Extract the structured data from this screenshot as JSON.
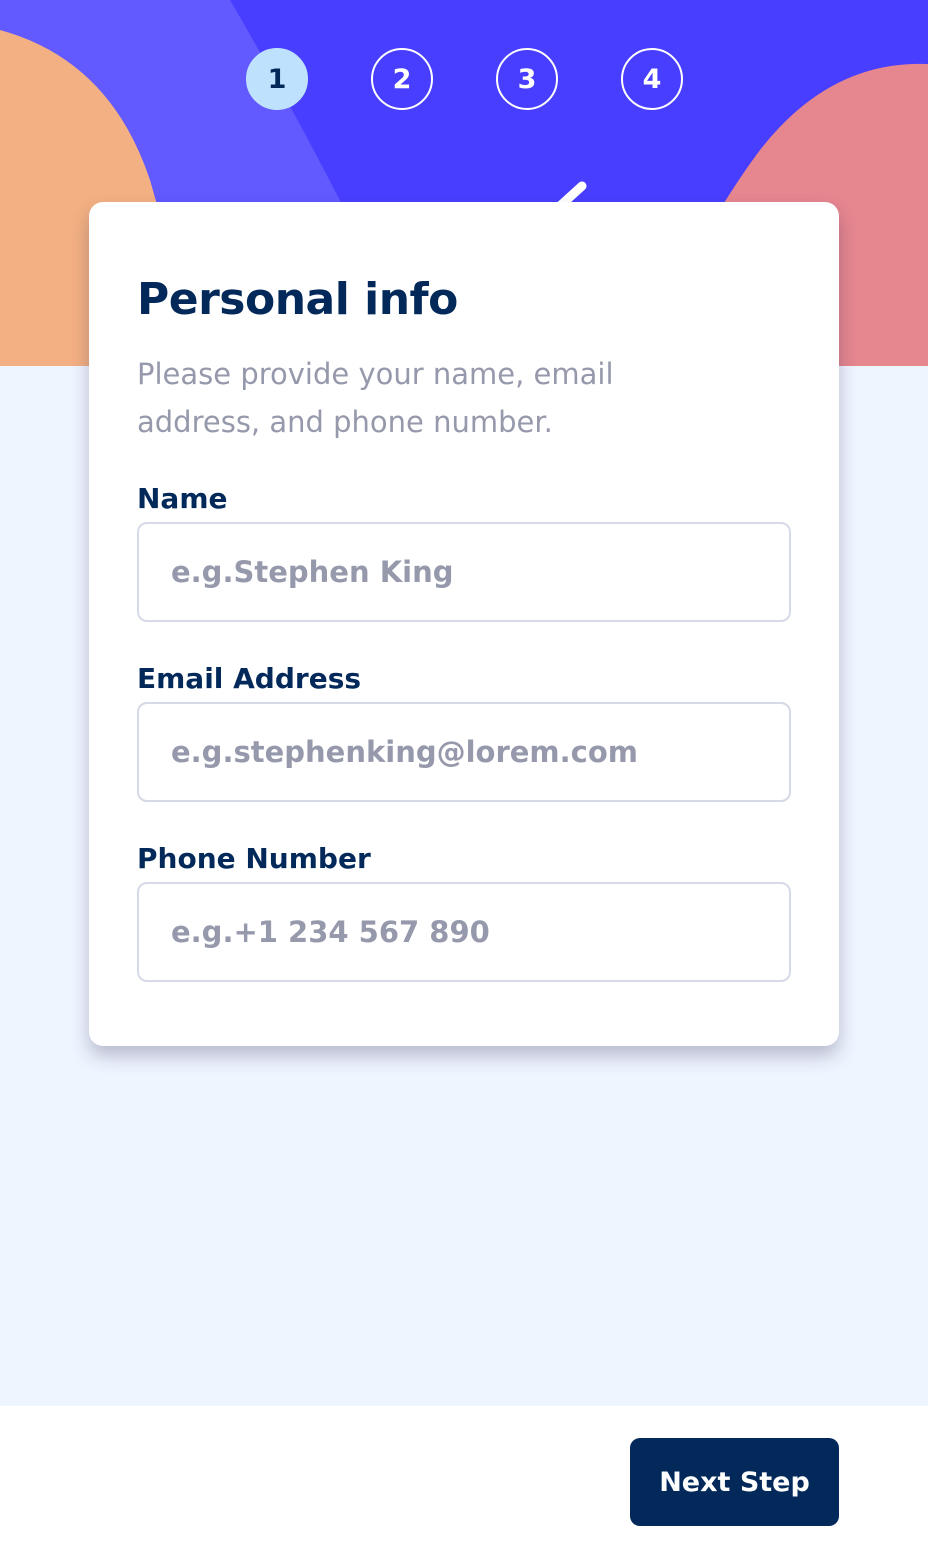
{
  "colors": {
    "header_bg": "#483eff",
    "header_light": "#6259ff",
    "orange_shape": "#ffaf7e",
    "pink_shape": "#f9818e",
    "page_bg": "#eff5ff",
    "marine_blue": "#02295a",
    "cool_gray": "#9699ab",
    "light_blue": "#bee2fd",
    "border": "#d6d9e6",
    "white": "#ffffff"
  },
  "steps": [
    {
      "number": "1",
      "active": true
    },
    {
      "number": "2",
      "active": false
    },
    {
      "number": "3",
      "active": false
    },
    {
      "number": "4",
      "active": false
    }
  ],
  "card": {
    "title": "Personal info",
    "subtitle": "Please provide your name, email address, and phone number."
  },
  "fields": {
    "name": {
      "label": "Name",
      "placeholder": "e.g.Stephen King",
      "value": ""
    },
    "email": {
      "label": "Email Address",
      "placeholder": "e.g.stephenking@lorem.com",
      "value": ""
    },
    "phone": {
      "label": "Phone Number",
      "placeholder": "e.g.+1 234 567 890",
      "value": ""
    }
  },
  "footer": {
    "next_label": "Next Step"
  }
}
